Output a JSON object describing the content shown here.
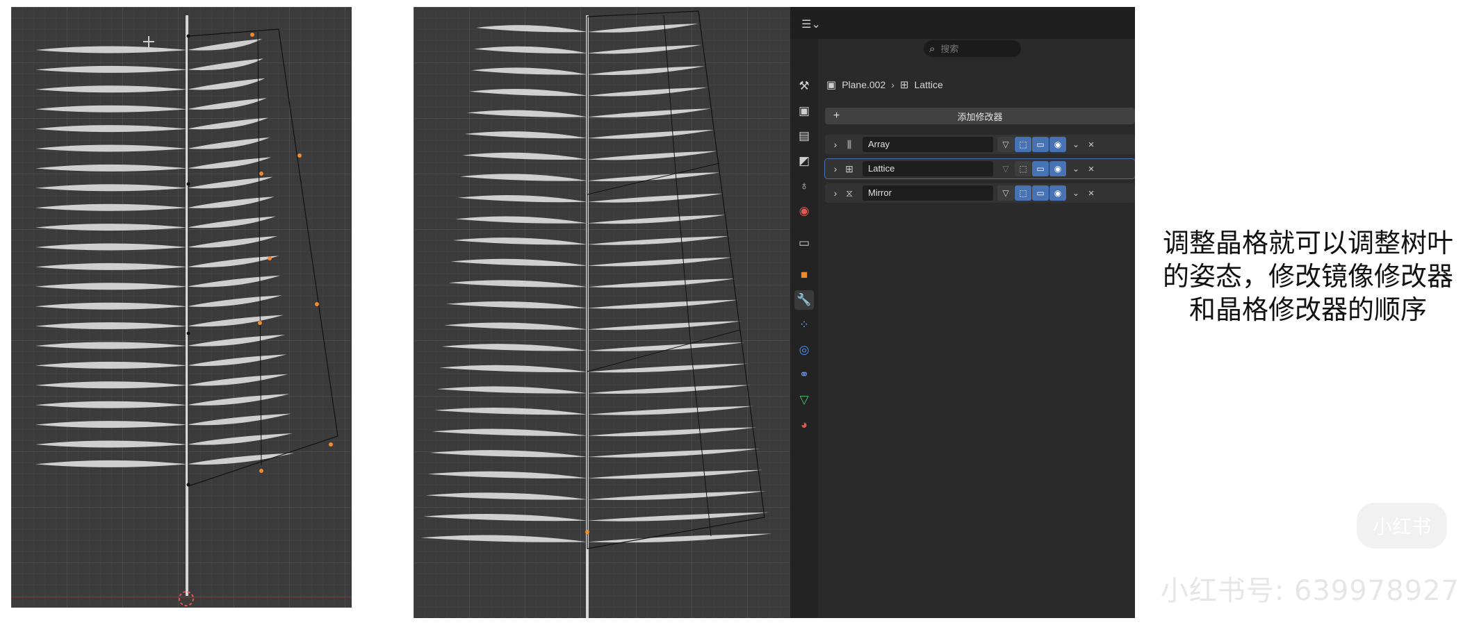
{
  "properties_editor": {
    "search_placeholder": "搜索",
    "breadcrumb": {
      "object": "Plane.002",
      "modifier": "Lattice"
    },
    "add_modifier_label": "添加修改器",
    "modifiers": [
      {
        "name": "Array",
        "icon": "array-modifier-icon"
      },
      {
        "name": "Lattice",
        "icon": "lattice-modifier-icon"
      },
      {
        "name": "Mirror",
        "icon": "mirror-modifier-icon"
      }
    ],
    "tabs": [
      "tool",
      "render",
      "output",
      "view-layer",
      "scene",
      "world",
      "collection",
      "object",
      "modifiers",
      "particles",
      "physics",
      "constraints",
      "data",
      "material"
    ],
    "active_tab": "modifiers",
    "accent_color": "#4772b3"
  },
  "caption": {
    "line1": "调整晶格就可以调整树叶",
    "line2": "的姿态，修改镜像修改器",
    "line3": "和晶格修改器的顺序"
  },
  "watermark": {
    "logo": "小红书",
    "id_text": "小红书号: 6399789​27"
  },
  "scene": {
    "leaf_count_left": 22,
    "leaf_count_right": 25
  }
}
